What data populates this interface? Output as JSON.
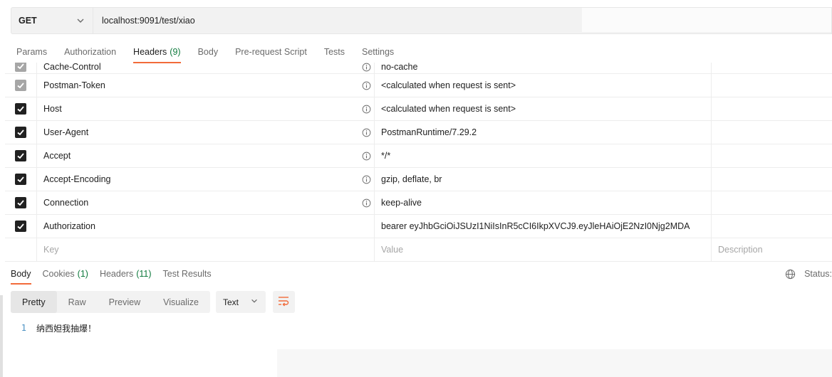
{
  "request": {
    "method": "GET",
    "url": "localhost:9091/test/xiao"
  },
  "request_tabs": [
    {
      "label": "Params",
      "count": ""
    },
    {
      "label": "Authorization",
      "count": ""
    },
    {
      "label": "Headers",
      "count": "(9)"
    },
    {
      "label": "Body",
      "count": ""
    },
    {
      "label": "Pre-request Script",
      "count": ""
    },
    {
      "label": "Tests",
      "count": ""
    },
    {
      "label": "Settings",
      "count": ""
    }
  ],
  "headers": [
    {
      "key": "Cache-Control",
      "value": "no-cache",
      "checked": true,
      "disabled": true,
      "info": true
    },
    {
      "key": "Postman-Token",
      "value": "<calculated when request is sent>",
      "checked": true,
      "disabled": true,
      "info": true
    },
    {
      "key": "Host",
      "value": "<calculated when request is sent>",
      "checked": true,
      "disabled": false,
      "info": true
    },
    {
      "key": "User-Agent",
      "value": "PostmanRuntime/7.29.2",
      "checked": true,
      "disabled": false,
      "info": true
    },
    {
      "key": "Accept",
      "value": "*/*",
      "checked": true,
      "disabled": false,
      "info": true
    },
    {
      "key": "Accept-Encoding",
      "value": "gzip, deflate, br",
      "checked": true,
      "disabled": false,
      "info": true
    },
    {
      "key": "Connection",
      "value": "keep-alive",
      "checked": true,
      "disabled": false,
      "info": true
    },
    {
      "key": "Authorization",
      "value": "bearer eyJhbGciOiJSUzI1NiIsInR5cCI6IkpXVCJ9.eyJleHAiOjE2NzI0Njg2MDA",
      "checked": true,
      "disabled": false,
      "info": false
    }
  ],
  "headers_placeholder": {
    "key": "Key",
    "value": "Value",
    "description": "Description"
  },
  "response_tabs": [
    {
      "label": "Body",
      "count": ""
    },
    {
      "label": "Cookies",
      "count": "(1)"
    },
    {
      "label": "Headers",
      "count": "(11)"
    },
    {
      "label": "Test Results",
      "count": ""
    }
  ],
  "status_label": "Status:",
  "view_modes": [
    "Pretty",
    "Raw",
    "Preview",
    "Visualize"
  ],
  "format": "Text",
  "response_body": [
    {
      "line": "1",
      "text": "纳西妲我抽爆！"
    }
  ],
  "colors": {
    "accent": "#f26b3a",
    "count": "#0f7a3d",
    "line_number": "#4a90c2"
  },
  "icons": {
    "info": "info-icon",
    "globe": "globe-icon",
    "wrap": "wrap-lines-icon",
    "chevron": "chevron-down-icon",
    "check": "check-icon"
  }
}
